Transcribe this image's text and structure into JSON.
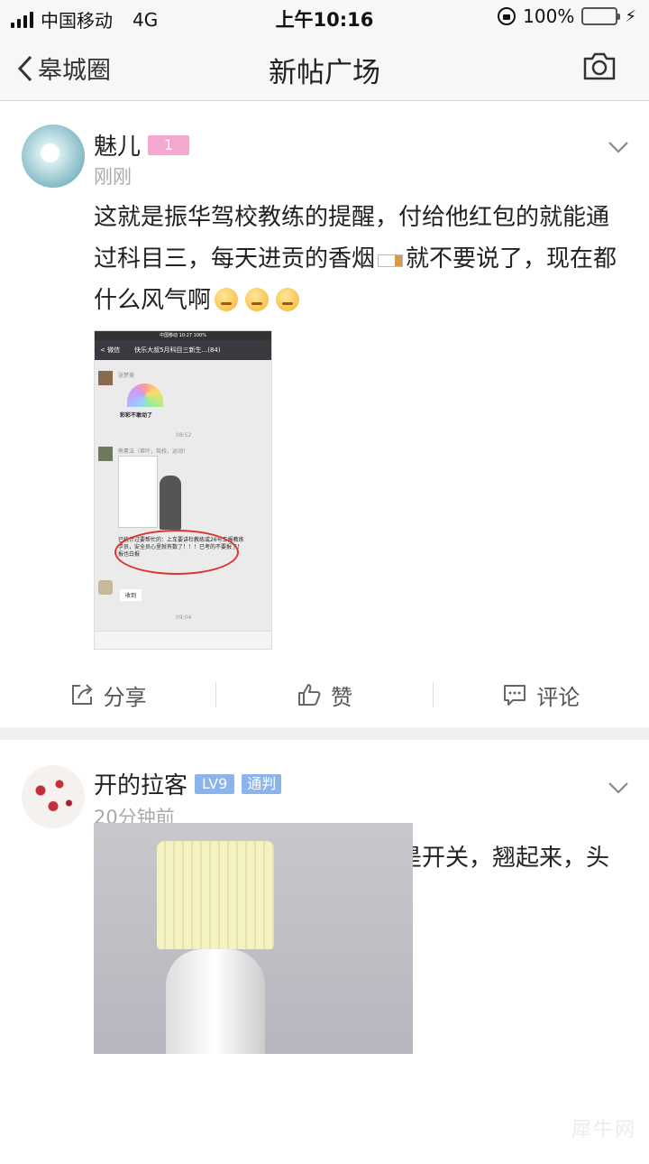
{
  "status": {
    "carrier": "中国移动",
    "network": "4G",
    "time": "上午10:16",
    "battery": "100%"
  },
  "nav": {
    "back_label": "皋城圈",
    "title": "新帖广场"
  },
  "posts": [
    {
      "user": "魅儿",
      "level": "1",
      "time": "刚刚",
      "text_a": "这就是振华驾校教练的提醒，付给他红包的就能通过科目三，每天进贡的香烟",
      "text_b": "就不要说了，现在都什么风气啊",
      "shot": {
        "status_carrier": "中国移动",
        "status_time": "10:27",
        "status_batt": "100%",
        "back": "微信",
        "title": "快乐大叔5月科目三新生...(84)",
        "sender1": "张梦美",
        "sticker": "彩彩不敢动了",
        "t1": "08:52",
        "sender2": "熊素法（茶叶，驾校，运动）",
        "notice": "已统计过要帮忙的：上车要讲杜教练或26号车报教练学员，安全员心里就有数了！！！已考的不要报了！报也白报",
        "reply": "收到",
        "t2": "09:04"
      },
      "actions": {
        "share": "分享",
        "like": "赞",
        "comment": "评论"
      }
    },
    {
      "user": "开的拉客",
      "level": "LV9",
      "tag": "通判",
      "time": "20分钟前",
      "text": "这款床头灯设计的很污，特别是开关，翘起来，头脑就发热！"
    }
  ],
  "watermark": "犀牛网",
  "colors": {
    "level1": "#f4a7cf",
    "lv9": "#8bb4ec",
    "tag": "#8bb4ec",
    "battery": "#4cd964"
  }
}
